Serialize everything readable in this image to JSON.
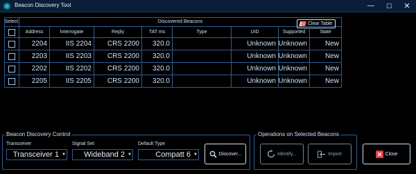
{
  "window": {
    "title": "Beacon Discovery Tool",
    "minimize": "—",
    "maximize": "☐",
    "close": "✕"
  },
  "grid": {
    "select_header": "Select",
    "group_header": "Discovered Beacons",
    "clear_label": "Clear Table",
    "columns": [
      "Address",
      "Interrogate",
      "Reply",
      "TAT ms",
      "Type",
      "UID",
      "Supported",
      "State"
    ],
    "rows": [
      {
        "address": "2204",
        "interrogate": "IIS 2204",
        "reply": "CRS 2200",
        "tat": "320.0",
        "type": "",
        "uid": "Unknown",
        "supported": "Unknown",
        "state": "New"
      },
      {
        "address": "2203",
        "interrogate": "IIS 2203",
        "reply": "CRS 2200",
        "tat": "320.0",
        "type": "",
        "uid": "Unknown",
        "supported": "Unknown",
        "state": "New"
      },
      {
        "address": "2202",
        "interrogate": "IIS 2202",
        "reply": "CRS 2200",
        "tat": "320.0",
        "type": "",
        "uid": "Unknown",
        "supported": "Unknown",
        "state": "New"
      },
      {
        "address": "2205",
        "interrogate": "IIS 2205",
        "reply": "CRS 2200",
        "tat": "320.0",
        "type": "",
        "uid": "Unknown",
        "supported": "Unknown",
        "state": "New"
      }
    ]
  },
  "discovery": {
    "title": "Beacon Discovery Control",
    "transceiver_label": "Transceiver",
    "transceiver_value": "Transceiver 1",
    "signal_label": "Signal Set",
    "signal_value": "Wideband 2",
    "default_type_label": "Default Type",
    "default_type_value": "Compatt 6",
    "discover_label": "Discover..."
  },
  "operations": {
    "title": "Operations on Selected Beacons",
    "identify_label": "Identify...",
    "import_label": "Import"
  },
  "close_label": "Close",
  "colors": {
    "background": "#000000",
    "border": "#2f5f93",
    "text": "#cfe3ff",
    "accent_icon": "#18b5c8",
    "close_icon": "#e23a3a"
  }
}
